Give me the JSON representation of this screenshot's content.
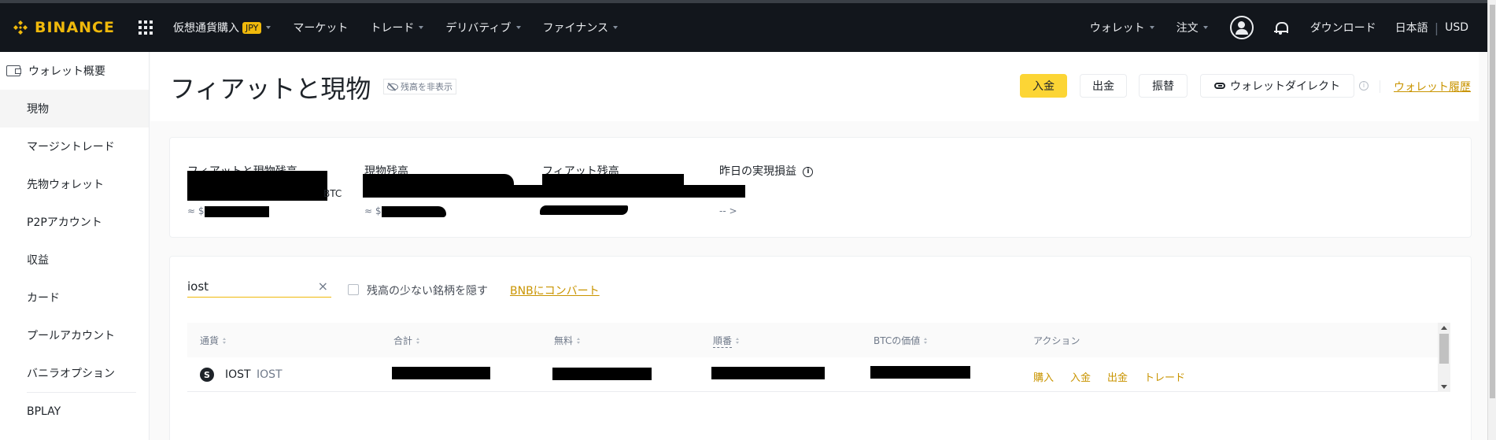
{
  "topnav": {
    "logo_text": "BINANCE",
    "left_items": [
      {
        "label": "仮想通貨購入",
        "badge": "JPY",
        "has_caret": true
      },
      {
        "label": "マーケット",
        "has_caret": false
      },
      {
        "label": "トレード",
        "has_caret": true
      },
      {
        "label": "デリバティブ",
        "has_caret": true
      },
      {
        "label": "ファイナンス",
        "has_caret": true
      }
    ],
    "wallet": "ウォレット",
    "orders": "注文",
    "download": "ダウンロード",
    "language": "日本語",
    "currency": "USD",
    "separator": "|"
  },
  "sidebar": {
    "items": [
      {
        "label": "ウォレット概要"
      },
      {
        "label": "現物"
      },
      {
        "label": "マージントレード"
      },
      {
        "label": "先物ウォレット"
      },
      {
        "label": "P2Pアカウント"
      },
      {
        "label": "収益"
      },
      {
        "label": "カード"
      },
      {
        "label": "プールアカウント"
      },
      {
        "label": "バニラオプション"
      },
      {
        "label": "BPLAY"
      }
    ]
  },
  "header": {
    "title": "フィアットと現物",
    "hide_balance": "残高を非表示",
    "deposit": "入金",
    "withdraw": "出金",
    "transfer": "振替",
    "wallet_direct": "ウォレットダイレクト",
    "info_symbol": "i",
    "history": "ウォレット履歴"
  },
  "balances": {
    "fiat_spot_label": "フィアットと現物残高",
    "fiat_spot_unit": "BTC",
    "fiat_spot_approx_prefix": "≈ $",
    "spot_label": "現物残高",
    "spot_approx_prefix": "≈ $",
    "fiat_label": "フィアット残高",
    "pnl_label": "昨日の実現損益",
    "pnl_info": "i",
    "pnl_value": "-- >"
  },
  "assets": {
    "search_value": "iost",
    "clear_symbol": "×",
    "hide_small_label": "残高の少ない銘柄を隠す",
    "convert_link": "BNBにコンバート",
    "columns": [
      "通貨",
      "合計",
      "無料",
      "順番",
      "BTCの価値",
      "アクション"
    ],
    "rows": [
      {
        "icon_letter": "S",
        "symbol": "IOST",
        "name": "IOST",
        "actions": [
          "購入",
          "入金",
          "出金",
          "トレード"
        ]
      }
    ]
  },
  "colors": {
    "brand": "#f0b90b",
    "primary_button": "#fcd535",
    "link": "#c99400",
    "topbar": "#12161c"
  }
}
